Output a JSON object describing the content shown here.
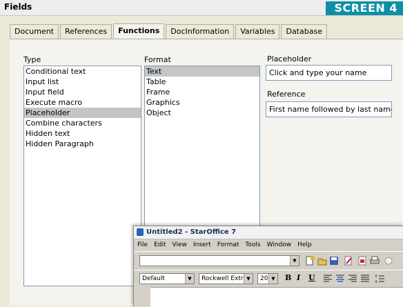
{
  "dialog": {
    "title": "Fields",
    "badge": "SCREEN 4",
    "tabs": [
      {
        "label": "Document"
      },
      {
        "label": "References"
      },
      {
        "label": "Functions"
      },
      {
        "label": "DocInformation"
      },
      {
        "label": "Variables"
      },
      {
        "label": "Database"
      }
    ],
    "type_label": "Type",
    "type_items": [
      "Conditional text",
      "Input list",
      "Input field",
      "Execute macro",
      "Placeholder",
      "Combine characters",
      "Hidden text",
      "Hidden Paragraph"
    ],
    "type_selected": "Placeholder",
    "format_label": "Format",
    "format_items": [
      "Text",
      "Table",
      "Frame",
      "Graphics",
      "Object"
    ],
    "format_selected": "Text",
    "placeholder_label": "Placeholder",
    "placeholder_value": "Click and type your name",
    "reference_label": "Reference",
    "reference_value": "First name followed by last name"
  },
  "staroffice": {
    "title": "Untitled2 - StarOffice 7",
    "menu": [
      "File",
      "Edit",
      "View",
      "Insert",
      "Format",
      "Tools",
      "Window",
      "Help"
    ],
    "style_value": "Default",
    "font_value": "Rockwell Extra Bo",
    "size_value": "20",
    "format_buttons": [
      "B",
      "I",
      "U"
    ]
  }
}
